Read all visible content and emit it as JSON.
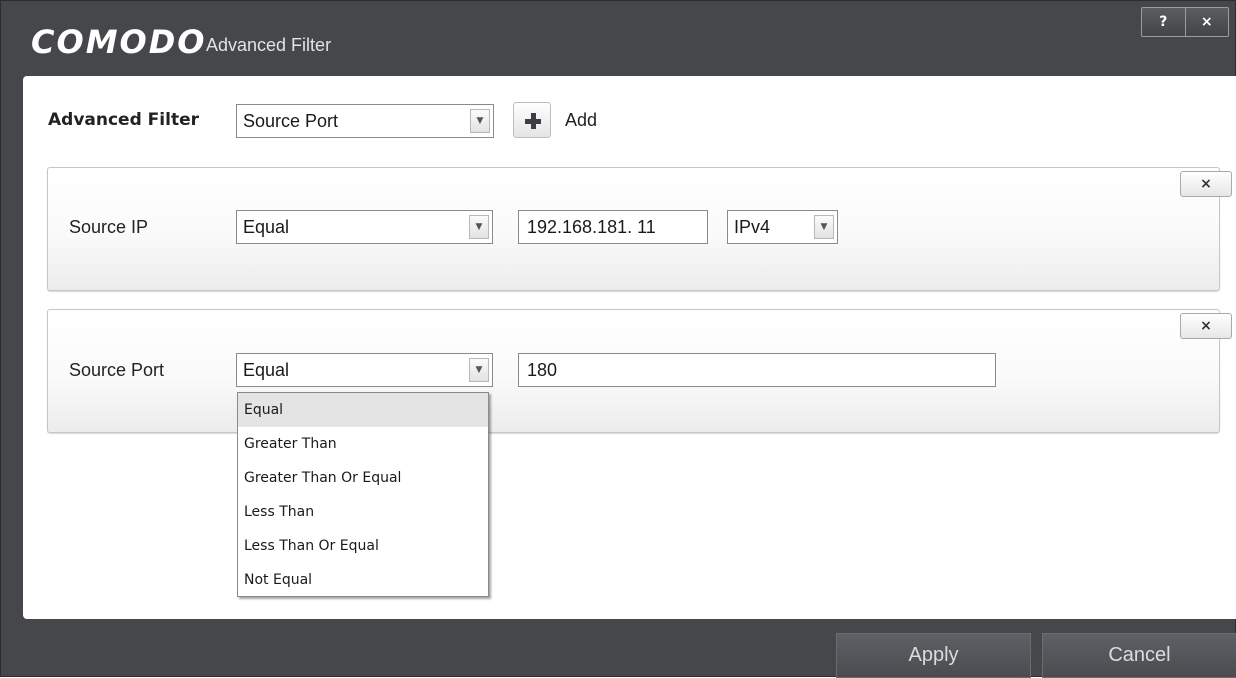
{
  "window": {
    "brand": "COMODO",
    "title": "Advanced Filter",
    "help_label": "?",
    "close_label": "×"
  },
  "toolbar": {
    "filter_label": "Advanced Filter",
    "filter_type_value": "Source Port",
    "add_label": "Add"
  },
  "filters": [
    {
      "name": "Source IP",
      "operator": "Equal",
      "value": "192.168.181. 11",
      "ip_version": "IPv4",
      "remove_label": "×"
    },
    {
      "name": "Source Port",
      "operator": "Equal",
      "value": "180",
      "remove_label": "×"
    }
  ],
  "operator_dropdown": {
    "options": [
      "Equal",
      "Greater Than",
      "Greater Than Or Equal",
      "Less Than",
      "Less Than Or Equal",
      "Not Equal"
    ],
    "selected": "Equal"
  },
  "footer": {
    "apply_label": "Apply",
    "cancel_label": "Cancel"
  },
  "colors": {
    "window_bg": "#45474a",
    "content_bg": "#ffffff",
    "selected_item_bg": "#e4e4e4"
  }
}
